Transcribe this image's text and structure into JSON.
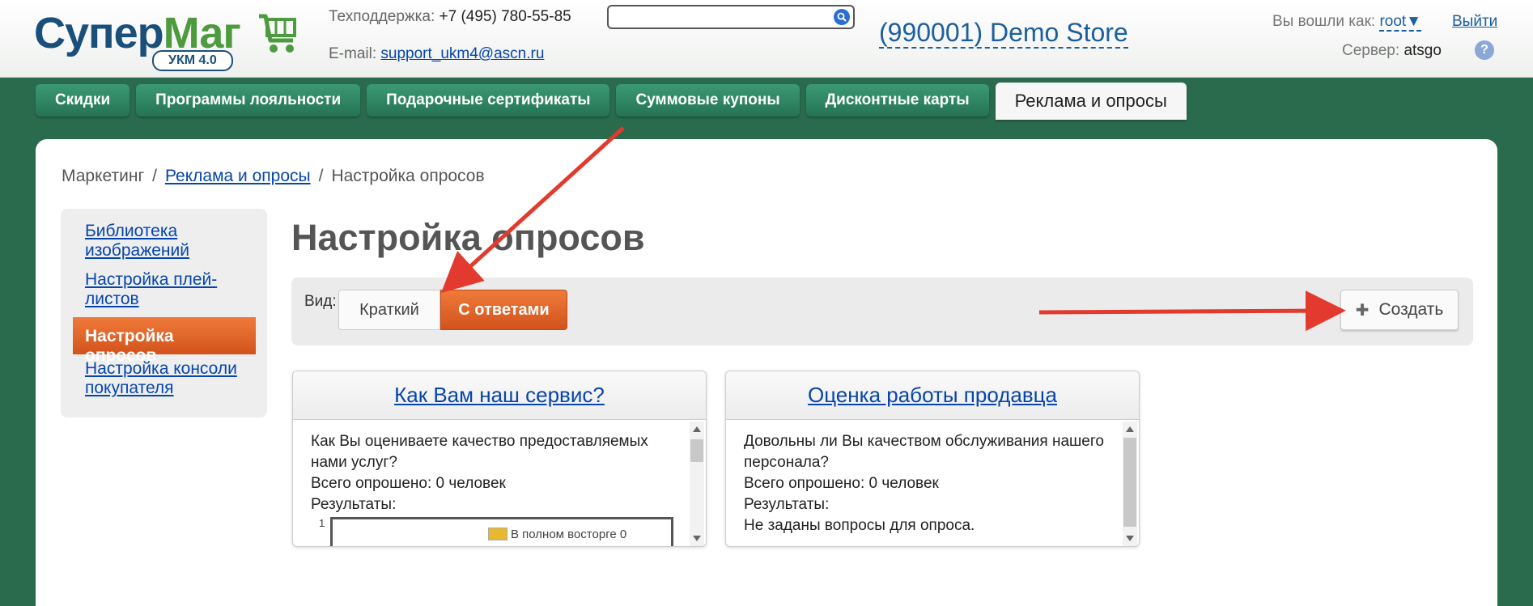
{
  "header": {
    "logo_text_a": "Супер",
    "logo_text_b": "Маг",
    "logo_badge": "УКМ 4.0",
    "support_label": "Техподдержка:",
    "support_phone": "+7 (495) 780-55-85",
    "email_label": "E-mail:",
    "email_value": "support_ukm4@ascn.ru",
    "search_value": "",
    "store": "(990001) Demo Store",
    "login_label": "Вы вошли как:",
    "login_user": "root",
    "logout": "Выйти",
    "server_label": "Сервер:",
    "server_value": "atsgo",
    "help": "?"
  },
  "tabs": [
    {
      "label": "Скидки"
    },
    {
      "label": "Программы лояльности"
    },
    {
      "label": "Подарочные сертификаты"
    },
    {
      "label": "Суммовые купоны"
    },
    {
      "label": "Дисконтные карты"
    },
    {
      "label": "Реклама и опросы",
      "active": true
    }
  ],
  "breadcrumb": {
    "root": "Маркетинг",
    "parent": "Реклама и опросы",
    "current": "Настройка опросов",
    "separator": "/"
  },
  "sidebar": {
    "items": [
      {
        "label": "Библиотека изображений"
      },
      {
        "label": "Настройка плей-листов"
      },
      {
        "label": "Настройка опросов",
        "active": true
      },
      {
        "label": "Настройка консоли покупателя"
      }
    ]
  },
  "page": {
    "title": "Настройка опросов",
    "view_label": "Вид:",
    "view_options": [
      "Краткий",
      "С ответами"
    ],
    "view_selected": "С ответами",
    "create_label": "Создать"
  },
  "cards": [
    {
      "title": "Как Вам наш сервис?",
      "question": "Как Вы оцениваете качество предоставляемых нами услуг?",
      "total": "Всего опрошено: 0 человек",
      "results_label": "Результаты:",
      "chart_axis": "1",
      "legend": "В полном восторге 0"
    },
    {
      "title": "Оценка работы продавца",
      "question": "Довольны ли Вы качеством обслуживания нашего персонала?",
      "total": "Всего опрошено: 0 человек",
      "results_label": "Результаты:",
      "note": "Не заданы вопросы для опроса."
    }
  ],
  "colors": {
    "background": "#2a6b4d",
    "tab": "#2f8563",
    "accent_orange": "#e0662a",
    "link": "#0645ad",
    "arrow": "#e23a2e"
  }
}
